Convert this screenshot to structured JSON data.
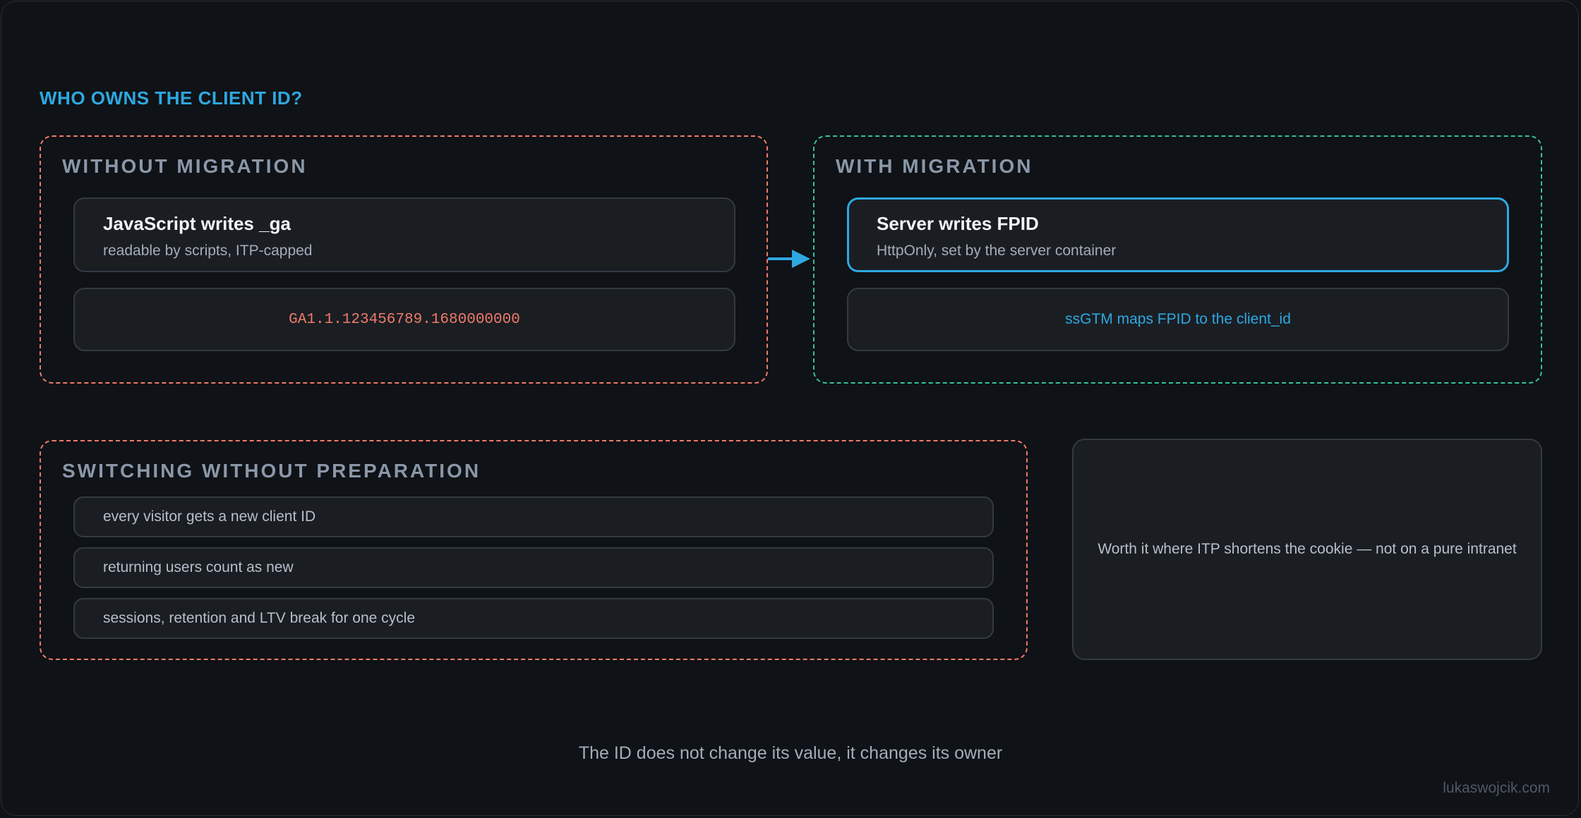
{
  "heading": "WHO OWNS THE CLIENT ID?",
  "without": {
    "title": "WITHOUT MIGRATION",
    "card_title": "JavaScript writes _ga",
    "card_sub": "readable by scripts, ITP-capped",
    "cookie_value": "GA1.1.123456789.1680000000"
  },
  "with": {
    "title": "WITH MIGRATION",
    "card_title": "Server writes FPID",
    "card_sub": "HttpOnly, set by the server container",
    "mapping": "ssGTM maps FPID to the client_id"
  },
  "switching": {
    "title": "SWITCHING WITHOUT PREPARATION",
    "items": [
      "every visitor gets a new client ID",
      "returning users count as new",
      "sessions, retention and LTV break for one cycle"
    ]
  },
  "note": "Worth it where ITP shortens the cookie — not on a pure intranet",
  "footer": "The ID does not change its value, it changes its owner",
  "credit": "lukaswojcik.com",
  "colors": {
    "accent": "#2ea8e0",
    "warning": "#f07a68",
    "success": "#35c2a0"
  }
}
